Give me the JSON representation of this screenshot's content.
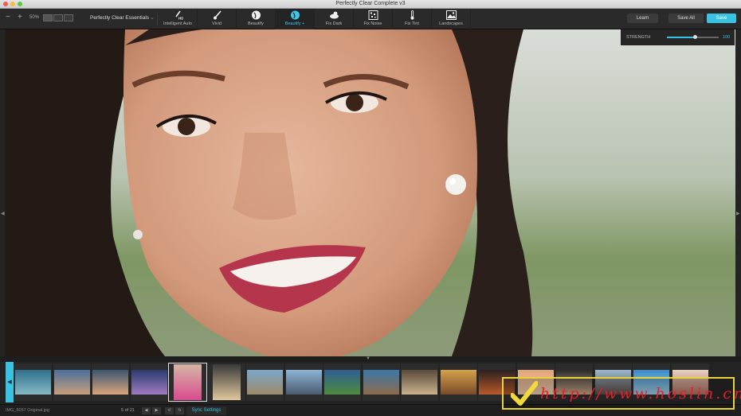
{
  "window": {
    "title": "Perfectly Clear Complete v3"
  },
  "toolbar": {
    "zoom_out": "−",
    "zoom_in": "+",
    "zoom_level": "50%",
    "preset": "Perfectly Clear Essentials",
    "tools": [
      {
        "label": "Intelligent Auto",
        "icon": "brush-hd-icon",
        "active": false
      },
      {
        "label": "Vivid",
        "icon": "brush-icon",
        "active": false
      },
      {
        "label": "Beautify",
        "icon": "face-icon",
        "active": false
      },
      {
        "label": "Beautify +",
        "icon": "face-plus-icon",
        "active": true
      },
      {
        "label": "Fix Dark",
        "icon": "fix-dark-icon",
        "active": false
      },
      {
        "label": "Fix Noise",
        "icon": "noise-icon",
        "active": false
      },
      {
        "label": "Fix Tint",
        "icon": "thermometer-icon",
        "active": false
      },
      {
        "label": "Landscapes",
        "icon": "landscape-icon",
        "active": false
      }
    ],
    "learn_label": "Learn",
    "save_all_label": "Save All",
    "save_label": "Save"
  },
  "strength": {
    "label": "STRENGTH",
    "value": "100",
    "fraction": 0.55
  },
  "filmstrip": {
    "thumbnails": [
      {
        "colors": [
          "#2f6f8c",
          "#86b9c4"
        ],
        "portrait": false,
        "selected": false
      },
      {
        "colors": [
          "#4a6f9e",
          "#c8a07a"
        ],
        "portrait": false,
        "selected": false
      },
      {
        "colors": [
          "#3a5673",
          "#d9a57a"
        ],
        "portrait": false,
        "selected": false
      },
      {
        "colors": [
          "#2a3a6e",
          "#a07cc0"
        ],
        "portrait": false,
        "selected": false
      },
      {
        "colors": [
          "#d5b7a6",
          "#d94a8f"
        ],
        "portrait": true,
        "selected": true
      },
      {
        "colors": [
          "#3a3a3a",
          "#e0c79c"
        ],
        "portrait": true,
        "selected": false
      },
      {
        "colors": [
          "#7aa7c7",
          "#9e8a6a"
        ],
        "portrait": false,
        "selected": false
      },
      {
        "colors": [
          "#8db4d6",
          "#4b5b6e"
        ],
        "portrait": false,
        "selected": false
      },
      {
        "colors": [
          "#2f5f93",
          "#4f8a3f"
        ],
        "portrait": false,
        "selected": false
      },
      {
        "colors": [
          "#3a78a8",
          "#8e6a4a"
        ],
        "portrait": false,
        "selected": false
      },
      {
        "colors": [
          "#5a4a3a",
          "#c9b28d"
        ],
        "portrait": false,
        "selected": false
      },
      {
        "colors": [
          "#d2a24a",
          "#7a4a2a"
        ],
        "portrait": false,
        "selected": false
      },
      {
        "colors": [
          "#2a2020",
          "#b85a2a"
        ],
        "portrait": false,
        "selected": false
      },
      {
        "colors": [
          "#e0a27a",
          "#f0d0b0"
        ],
        "portrait": false,
        "selected": false
      },
      {
        "colors": [
          "#2a2a2a",
          "#caa88a"
        ],
        "portrait": false,
        "selected": false
      },
      {
        "colors": [
          "#9ab8d0",
          "#5a4a40"
        ],
        "portrait": false,
        "selected": false
      },
      {
        "colors": [
          "#3a8ac6",
          "#9ed0e8"
        ],
        "portrait": false,
        "selected": false
      },
      {
        "colors": [
          "#e8d0c0",
          "#b07060"
        ],
        "portrait": false,
        "selected": false
      }
    ]
  },
  "status": {
    "filename": "IMG_5057 Original.jpg",
    "counter": "5 of 21",
    "sync_label": "Sync Settings"
  },
  "watermark": {
    "text": "http://www.hoslin.cn/"
  }
}
